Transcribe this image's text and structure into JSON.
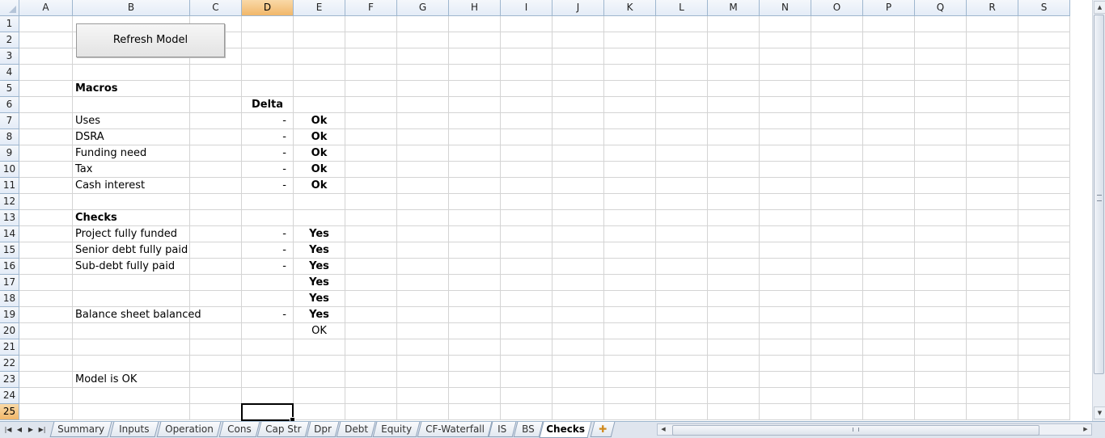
{
  "columns": [
    "A",
    "B",
    "C",
    "D",
    "E",
    "F",
    "G",
    "H",
    "I",
    "J",
    "K",
    "L",
    "M",
    "N",
    "O",
    "P",
    "Q",
    "R",
    "S"
  ],
  "selected_column": "D",
  "selected_row": "25",
  "rows": [
    "1",
    "2",
    "3",
    "4",
    "5",
    "6",
    "7",
    "8",
    "9",
    "10",
    "11",
    "12",
    "13",
    "14",
    "15",
    "16",
    "17",
    "18",
    "19",
    "20",
    "21",
    "22",
    "23",
    "24",
    "25"
  ],
  "button": {
    "label": "Refresh Model"
  },
  "sections": {
    "macros_title": "Macros",
    "delta_header": "Delta",
    "checks_title": "Checks"
  },
  "macros": [
    {
      "label": "Uses",
      "delta": "-",
      "status": "Ok"
    },
    {
      "label": "DSRA",
      "delta": "-",
      "status": "Ok"
    },
    {
      "label": "Funding need",
      "delta": "-",
      "status": "Ok"
    },
    {
      "label": "Tax",
      "delta": "-",
      "status": "Ok"
    },
    {
      "label": "Cash interest",
      "delta": "-",
      "status": "Ok"
    }
  ],
  "checks": [
    {
      "label": "Project fully funded",
      "delta": "-",
      "status": "Yes"
    },
    {
      "label": "Senior debt fully paid",
      "delta": "-",
      "status": "Yes"
    },
    {
      "label": "Sub-debt fully paid",
      "delta": "-",
      "status": "Yes"
    },
    {
      "label": "",
      "delta": "",
      "status": "Yes"
    },
    {
      "label": "",
      "delta": "",
      "status": "Yes"
    },
    {
      "label": "Balance sheet balanced",
      "delta": "-",
      "status": "Yes"
    }
  ],
  "summary_ok": "OK",
  "model_status": "Model is OK",
  "sheet_tabs": [
    "Summary",
    "Inputs",
    "Operation",
    "Cons",
    "Cap Str",
    "Dpr",
    "Debt",
    "Equity",
    "CF-Waterfall",
    "IS",
    "BS",
    "Checks"
  ],
  "active_tab": "Checks",
  "colors": {
    "header_bg": "#e4ecf7",
    "header_selected": "#f1b76a",
    "gridline": "#d4d4d4"
  }
}
